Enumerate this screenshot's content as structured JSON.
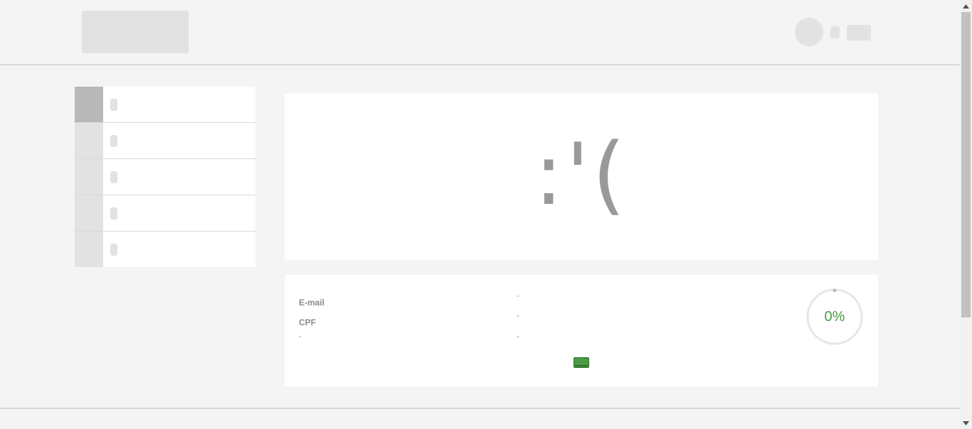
{
  "error": {
    "face": ":'("
  },
  "info": {
    "email_label": "E-mail",
    "cpf_label": "CPF",
    "dash_left": "-",
    "dash_right_1": "-",
    "dash_right_2": "-",
    "dash_right_3": "-"
  },
  "progress": {
    "value": 0,
    "label": "0%"
  },
  "colors": {
    "accent_green": "#4a9a46",
    "placeholder_gray": "#e2e2e2",
    "active_gray": "#b8b8b8"
  }
}
